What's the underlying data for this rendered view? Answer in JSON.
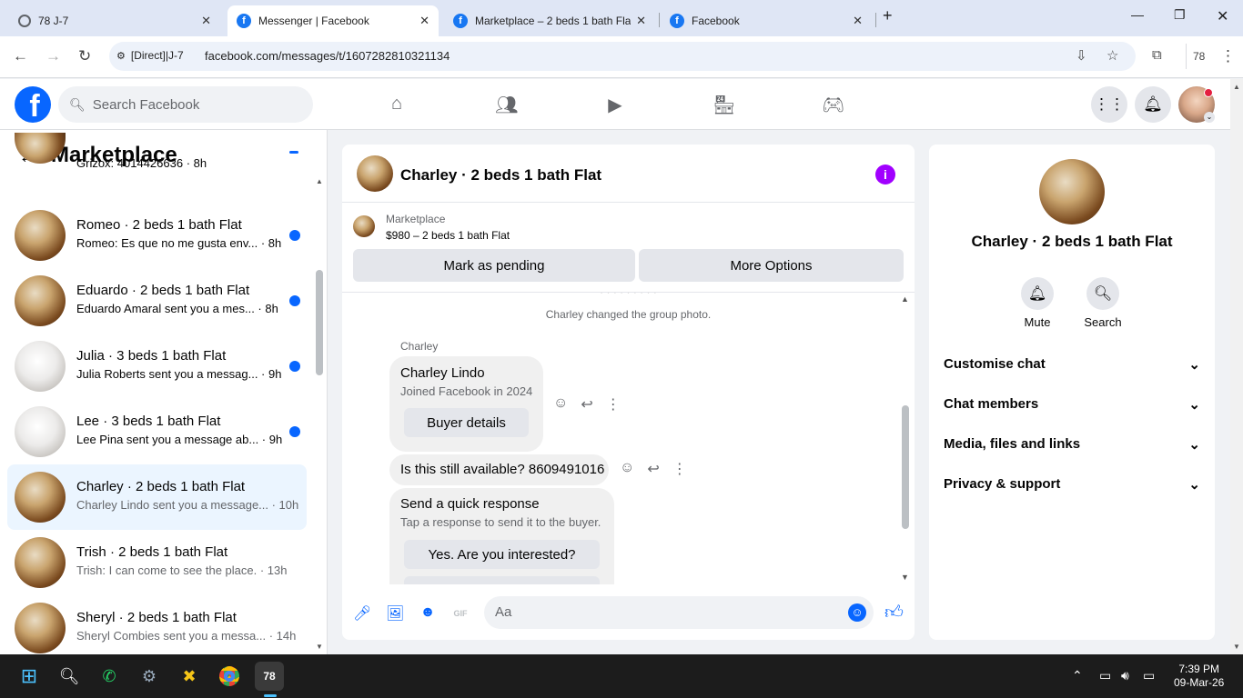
{
  "browser": {
    "tabs": [
      {
        "title": "78 J-7",
        "icon": "globe-icon"
      },
      {
        "title": "Messenger | Facebook",
        "icon": "facebook-icon"
      },
      {
        "title": "Marketplace – 2 beds 1 bath Fla",
        "icon": "facebook-icon"
      },
      {
        "title": "Facebook",
        "icon": "facebook-icon"
      }
    ],
    "site_chip": "[Direct]|J-7",
    "url": "facebook.com/messages/t/1607282810321134",
    "profile_badge": "78"
  },
  "fb_header": {
    "logo": "f",
    "search_placeholder": "Search Facebook"
  },
  "left_panel": {
    "title": "Marketplace",
    "conversations": [
      {
        "name": "",
        "preview": "Grizox: 4014426636 · 8h",
        "unread": true,
        "avatar": "wood"
      },
      {
        "name": "Romeo · 2 beds 1 bath Flat",
        "preview": "Romeo: Es que no me gusta env... · 8h",
        "unread": true,
        "avatar": "wood"
      },
      {
        "name": "Eduardo · 2 beds 1 bath Flat",
        "preview": "Eduardo Amaral sent you a mes... · 8h",
        "unread": true,
        "avatar": "wood"
      },
      {
        "name": "Julia · 3 beds 1 bath Flat",
        "preview": "Julia Roberts sent you a messag... · 9h",
        "unread": true,
        "avatar": "white"
      },
      {
        "name": "Lee · 3 beds 1 bath Flat",
        "preview": "Lee Pina sent you a message ab... · 9h",
        "unread": true,
        "avatar": "white"
      },
      {
        "name": "Charley · 2 beds 1 bath Flat",
        "preview": "Charley Lindo sent you a message... · 10h",
        "unread": false,
        "selected": true,
        "avatar": "wood"
      },
      {
        "name": "Trish · 2 beds 1 bath Flat",
        "preview": "Trish: I can come to see the place. · 13h",
        "unread": false,
        "avatar": "wood"
      },
      {
        "name": "Sheryl · 2 beds 1 bath Flat",
        "preview": "Sheryl Combies sent you a messa... · 14h",
        "unread": false,
        "avatar": "wood"
      }
    ]
  },
  "chat": {
    "title": "Charley · 2 beds 1 bath Flat",
    "marketplace_label": "Marketplace",
    "listing": "$980 – 2 beds 1 bath Flat",
    "mark_pending": "Mark as pending",
    "more_options": "More Options",
    "system_message": "Charley changed the group photo.",
    "sender": "Charley",
    "profile_card": {
      "name": "Charley Lindo",
      "joined": "Joined Facebook in 2024",
      "button": "Buyer details"
    },
    "message": "Is this still available? 8609491016",
    "quick_response": {
      "title": "Send a quick response",
      "subtitle": "Tap a response to send it to the buyer.",
      "option": "Yes. Are you interested?"
    },
    "composer_placeholder": "Aa"
  },
  "right_panel": {
    "name": "Charley · 2 beds 1 bath Flat",
    "mute": "Mute",
    "search": "Search",
    "sections": [
      "Customise chat",
      "Chat members",
      "Media, files and links",
      "Privacy & support"
    ]
  },
  "taskbar": {
    "time": "7:39 PM",
    "date": "09-Mar-26",
    "app_badge": "78"
  },
  "colors": {
    "fb_blue": "#0866ff",
    "unread_dot": "#0866ff",
    "info_purple": "#a100ff",
    "selected_row": "#ebf5ff"
  }
}
